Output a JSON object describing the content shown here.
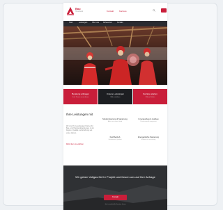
{
  "header": {
    "logo_text": "Bau",
    "logo_sub": "Handwerk",
    "links": [
      "Kontakt",
      "Karriere"
    ],
    "search_icon": "search-icon",
    "menu_icon": "menu-icon"
  },
  "nav": {
    "items": [
      "Start",
      "Leistungen",
      "Über uns",
      "Referenzen",
      "Kontakt"
    ]
  },
  "hero": {
    "image_alt": "workers"
  },
  "cards": [
    {
      "title": "Beratung anfragen",
      "sub": "Jetzt Termin vereinbaren",
      "color": "#c91e3a"
    },
    {
      "title": "Unsere Leistungen",
      "sub": "Mehr erfahren",
      "color": "#1d1e22"
    },
    {
      "title": "Karriere starten",
      "sub": "Offene Stellen",
      "color": "#c91e3a"
    }
  ],
  "about": {
    "heading": "Ihre Leistungen mit",
    "paragraph": "Wir sind Ihr zuverlässiger Partner für Bau- und Handwerksleistungen in der Region. Qualität und Erfahrung seit vielen Jahren.",
    "link": "Mehr über uns erfahren",
    "features": [
      {
        "title": "Modernisierung & Sanierung",
        "sub": "Alles aus einer Hand"
      },
      {
        "title": "Innenausbau & Ausbau",
        "sub": "Professionell umgesetzt"
      },
      {
        "title": "Fachbetrieb",
        "sub": "Zertifizierte Qualität"
      },
      {
        "title": "Energetische Sanierung",
        "sub": "Effizient & nachhaltig"
      }
    ]
  },
  "cta": {
    "text": "Wir geben Vollgas für Ihr Projekt und freuen uns auf Ihre Anfrage",
    "button": "Kontakt",
    "small": "Jetzt unverbindlich beraten lassen"
  }
}
